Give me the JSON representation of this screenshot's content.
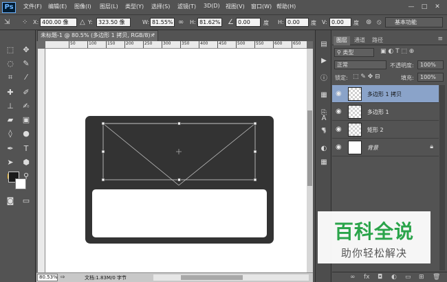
{
  "app": {
    "logo": "Ps",
    "menus": [
      "文件(F)",
      "编辑(E)",
      "图像(I)",
      "图层(L)",
      "类型(Y)",
      "选择(S)",
      "滤镜(T)",
      "3D(D)",
      "视图(V)",
      "窗口(W)",
      "帮助(H)"
    ],
    "window_controls": [
      "—",
      "□",
      "✕"
    ]
  },
  "options": {
    "x_label": "X:",
    "x_value": "400.00 像",
    "y_label": "Y:",
    "y_value": "323.50 像",
    "w_label": "W:",
    "w_value": "81.55%",
    "h_label": "H:",
    "h_value": "81.62%",
    "angle_value": "0.00",
    "angle_unit": "度",
    "hskew_label": "H:",
    "hskew_value": "0.00",
    "hskew_unit": "度",
    "vskew_label": "V:",
    "vskew_value": "0.00",
    "vskew_unit": "度",
    "workspace": "基本功能"
  },
  "document": {
    "tab_title": "未标题-1 @ 80.5% (多边形 1 拷贝, RGB/8) *",
    "zoom": "80.53%",
    "doc_info": "文档:1.83M/0 字节",
    "ruler_ticks": [
      "50",
      "100",
      "150",
      "200",
      "250",
      "300",
      "350",
      "400",
      "450",
      "500",
      "550",
      "600",
      "650",
      "700"
    ]
  },
  "layers_panel": {
    "tabs": [
      "图层",
      "通道",
      "路径"
    ],
    "filter_kind": "类型",
    "blend_mode": "正常",
    "opacity_label": "不透明度:",
    "opacity_value": "100%",
    "lock_label": "锁定:",
    "fill_label": "填充:",
    "fill_value": "100%",
    "layers": [
      {
        "name": "多边形 1 拷贝",
        "selected": true
      },
      {
        "name": "多边形 1",
        "selected": false
      },
      {
        "name": "矩形 2",
        "selected": false
      },
      {
        "name": "背景",
        "selected": false
      }
    ],
    "footer_icons": [
      "link-icon",
      "fx-icon",
      "mask-icon",
      "adjustment-icon",
      "group-icon",
      "new-layer-icon",
      "trash-icon"
    ]
  },
  "watermark": {
    "title": "百科全说",
    "subtitle": "助你轻松解决"
  },
  "colors": {
    "envelope": "#333333",
    "selected_layer": "#8aa3c9",
    "watermark_green": "#2aa44a"
  }
}
